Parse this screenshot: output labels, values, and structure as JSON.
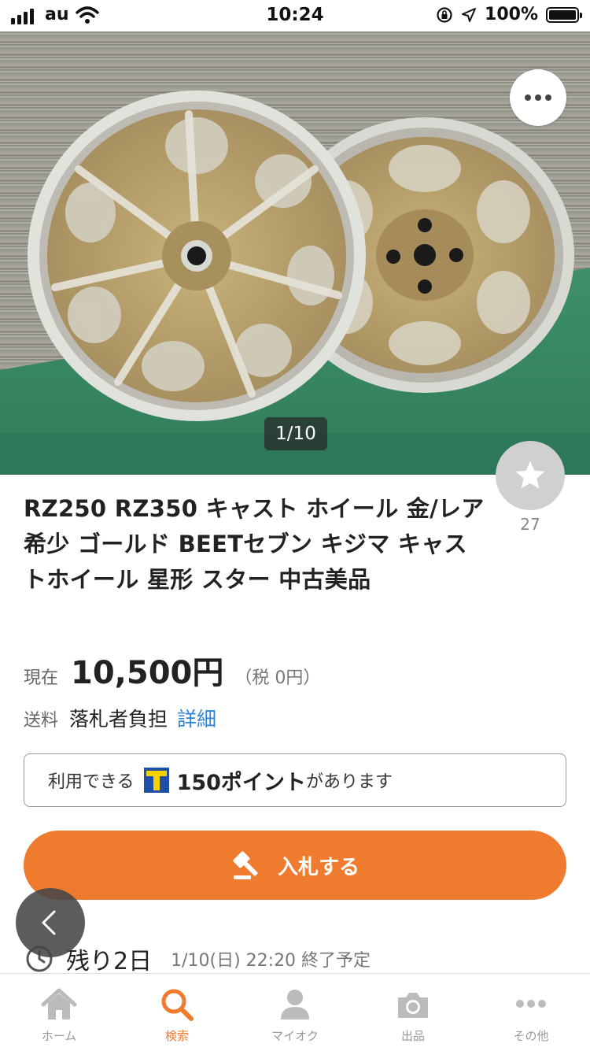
{
  "status_bar": {
    "carrier": "au",
    "time": "10:24",
    "battery": "100%",
    "battery_level": 1.0
  },
  "gallery": {
    "pager": "1/10",
    "current_index": 1,
    "total": 10
  },
  "watch": {
    "count": "27"
  },
  "item": {
    "title": "RZ250 RZ350 キャスト ホイール 金/レア 希少 ゴールド BEETセブン キジマ キャストホイール 星形 スター 中古美品"
  },
  "price": {
    "label": "現在",
    "value": "10,500円",
    "tax": "（税 0円）"
  },
  "shipping": {
    "label": "送料",
    "value": "落札者負担",
    "detail_link": "詳細"
  },
  "points": {
    "prefix": "利用できる",
    "value": "150ポイント",
    "suffix": "があります"
  },
  "bid": {
    "label": "入札する"
  },
  "time_left": {
    "remaining": "残り2日",
    "end": "1/10(日) 22:20 終了予定"
  },
  "tabs": [
    {
      "label": "ホーム",
      "icon": "home-icon"
    },
    {
      "label": "検索",
      "icon": "search-icon"
    },
    {
      "label": "マイオク",
      "icon": "person-icon"
    },
    {
      "label": "出品",
      "icon": "camera-icon"
    },
    {
      "label": "その他",
      "icon": "more-icon"
    }
  ],
  "active_tab": "検索",
  "colors": {
    "accent": "#ef7b2f",
    "link": "#2d84d8",
    "t_point_blue": "#1f4fa8",
    "t_point_yellow": "#f5d200"
  }
}
